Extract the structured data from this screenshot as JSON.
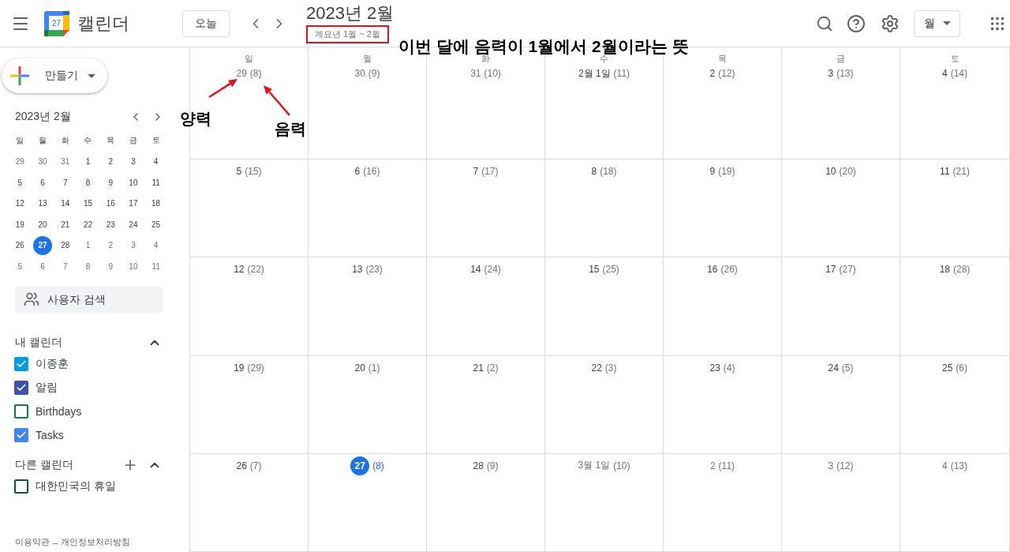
{
  "header": {
    "logo_day": "27",
    "app_name": "캘린더",
    "today_button": "오늘",
    "title": "2023년 2월",
    "subtitle": "계묘년 1월 ~ 2월",
    "subtitle_boxed": true,
    "view_button": "월"
  },
  "sidebar": {
    "create_button": "만들기",
    "mini_calendar": {
      "title": "2023년 2월",
      "weekdays": [
        "일",
        "월",
        "화",
        "수",
        "목",
        "금",
        "토"
      ],
      "weeks": [
        [
          {
            "day": "29",
            "in_month": false,
            "selected": false
          },
          {
            "day": "30",
            "in_month": false,
            "selected": false
          },
          {
            "day": "31",
            "in_month": false,
            "selected": false
          },
          {
            "day": "1",
            "in_month": true,
            "selected": false
          },
          {
            "day": "2",
            "in_month": true,
            "selected": false
          },
          {
            "day": "3",
            "in_month": true,
            "selected": false
          },
          {
            "day": "4",
            "in_month": true,
            "selected": false
          }
        ],
        [
          {
            "day": "5",
            "in_month": true,
            "selected": false
          },
          {
            "day": "6",
            "in_month": true,
            "selected": false
          },
          {
            "day": "7",
            "in_month": true,
            "selected": false
          },
          {
            "day": "8",
            "in_month": true,
            "selected": false
          },
          {
            "day": "9",
            "in_month": true,
            "selected": false
          },
          {
            "day": "10",
            "in_month": true,
            "selected": false
          },
          {
            "day": "11",
            "in_month": true,
            "selected": false
          }
        ],
        [
          {
            "day": "12",
            "in_month": true,
            "selected": false
          },
          {
            "day": "13",
            "in_month": true,
            "selected": false
          },
          {
            "day": "14",
            "in_month": true,
            "selected": false
          },
          {
            "day": "15",
            "in_month": true,
            "selected": false
          },
          {
            "day": "16",
            "in_month": true,
            "selected": false
          },
          {
            "day": "17",
            "in_month": true,
            "selected": false
          },
          {
            "day": "18",
            "in_month": true,
            "selected": false
          }
        ],
        [
          {
            "day": "19",
            "in_month": true,
            "selected": false
          },
          {
            "day": "20",
            "in_month": true,
            "selected": false
          },
          {
            "day": "21",
            "in_month": true,
            "selected": false
          },
          {
            "day": "22",
            "in_month": true,
            "selected": false
          },
          {
            "day": "23",
            "in_month": true,
            "selected": false
          },
          {
            "day": "24",
            "in_month": true,
            "selected": false
          },
          {
            "day": "25",
            "in_month": true,
            "selected": false
          }
        ],
        [
          {
            "day": "26",
            "in_month": true,
            "selected": false
          },
          {
            "day": "27",
            "in_month": true,
            "selected": true
          },
          {
            "day": "28",
            "in_month": true,
            "selected": false
          },
          {
            "day": "1",
            "in_month": false,
            "selected": false
          },
          {
            "day": "2",
            "in_month": false,
            "selected": false
          },
          {
            "day": "3",
            "in_month": false,
            "selected": false
          },
          {
            "day": "4",
            "in_month": false,
            "selected": false
          }
        ],
        [
          {
            "day": "5",
            "in_month": false,
            "selected": false
          },
          {
            "day": "6",
            "in_month": false,
            "selected": false
          },
          {
            "day": "7",
            "in_month": false,
            "selected": false
          },
          {
            "day": "8",
            "in_month": false,
            "selected": false
          },
          {
            "day": "9",
            "in_month": false,
            "selected": false
          },
          {
            "day": "10",
            "in_month": false,
            "selected": false
          },
          {
            "day": "11",
            "in_month": false,
            "selected": false
          }
        ]
      ]
    },
    "people_search": {
      "placeholder": "사용자 검색"
    },
    "calendar_groups": [
      {
        "title": "내 캘린더",
        "expanded": true,
        "can_add": false,
        "items": [
          {
            "label": "이종훈",
            "checked": true,
            "color": "#039be5"
          },
          {
            "label": "알림",
            "checked": true,
            "color": "#3f51b5"
          },
          {
            "label": "Birthdays",
            "checked": false,
            "color": "#0b8043"
          },
          {
            "label": "Tasks",
            "checked": true,
            "color": "#4285f4"
          }
        ]
      },
      {
        "title": "다른 캘린더",
        "expanded": true,
        "can_add": true,
        "items": [
          {
            "label": "대한민국의 휴일",
            "checked": false,
            "color": "#0b5c1f"
          }
        ]
      }
    ],
    "footer": {
      "links": [
        "이용약관",
        "개인정보처리방침"
      ],
      "separator": "–"
    }
  },
  "month_grid": {
    "weekdays": [
      "일",
      "월",
      "화",
      "수",
      "목",
      "금",
      "토"
    ],
    "weeks": [
      [
        {
          "date": "29",
          "lunar": "(8)",
          "in_month": false,
          "today": false
        },
        {
          "date": "30",
          "lunar": "(9)",
          "in_month": false,
          "today": false
        },
        {
          "date": "31",
          "lunar": "(10)",
          "in_month": false,
          "today": false
        },
        {
          "date": "2월 1일",
          "lunar": "(11)",
          "in_month": true,
          "today": false
        },
        {
          "date": "2",
          "lunar": "(12)",
          "in_month": true,
          "today": false
        },
        {
          "date": "3",
          "lunar": "(13)",
          "in_month": true,
          "today": false
        },
        {
          "date": "4",
          "lunar": "(14)",
          "in_month": true,
          "today": false
        }
      ],
      [
        {
          "date": "5",
          "lunar": "(15)",
          "in_month": true,
          "today": false
        },
        {
          "date": "6",
          "lunar": "(16)",
          "in_month": true,
          "today": false
        },
        {
          "date": "7",
          "lunar": "(17)",
          "in_month": true,
          "today": false
        },
        {
          "date": "8",
          "lunar": "(18)",
          "in_month": true,
          "today": false
        },
        {
          "date": "9",
          "lunar": "(19)",
          "in_month": true,
          "today": false
        },
        {
          "date": "10",
          "lunar": "(20)",
          "in_month": true,
          "today": false
        },
        {
          "date": "11",
          "lunar": "(21)",
          "in_month": true,
          "today": false
        }
      ],
      [
        {
          "date": "12",
          "lunar": "(22)",
          "in_month": true,
          "today": false
        },
        {
          "date": "13",
          "lunar": "(23)",
          "in_month": true,
          "today": false
        },
        {
          "date": "14",
          "lunar": "(24)",
          "in_month": true,
          "today": false
        },
        {
          "date": "15",
          "lunar": "(25)",
          "in_month": true,
          "today": false
        },
        {
          "date": "16",
          "lunar": "(26)",
          "in_month": true,
          "today": false
        },
        {
          "date": "17",
          "lunar": "(27)",
          "in_month": true,
          "today": false
        },
        {
          "date": "18",
          "lunar": "(28)",
          "in_month": true,
          "today": false
        }
      ],
      [
        {
          "date": "19",
          "lunar": "(29)",
          "in_month": true,
          "today": false
        },
        {
          "date": "20",
          "lunar": "(1)",
          "in_month": true,
          "today": false
        },
        {
          "date": "21",
          "lunar": "(2)",
          "in_month": true,
          "today": false
        },
        {
          "date": "22",
          "lunar": "(3)",
          "in_month": true,
          "today": false
        },
        {
          "date": "23",
          "lunar": "(4)",
          "in_month": true,
          "today": false
        },
        {
          "date": "24",
          "lunar": "(5)",
          "in_month": true,
          "today": false
        },
        {
          "date": "25",
          "lunar": "(6)",
          "in_month": true,
          "today": false
        }
      ],
      [
        {
          "date": "26",
          "lunar": "(7)",
          "in_month": true,
          "today": false
        },
        {
          "date": "27",
          "lunar": "(8)",
          "in_month": true,
          "today": true
        },
        {
          "date": "28",
          "lunar": "(9)",
          "in_month": true,
          "today": false
        },
        {
          "date": "3월 1일",
          "lunar": "(10)",
          "in_month": false,
          "today": false
        },
        {
          "date": "2",
          "lunar": "(11)",
          "in_month": false,
          "today": false
        },
        {
          "date": "3",
          "lunar": "(12)",
          "in_month": false,
          "today": false
        },
        {
          "date": "4",
          "lunar": "(13)",
          "in_month": false,
          "today": false
        }
      ]
    ]
  },
  "annotations": {
    "note": "이번 달에 음력이 1월에서 2월이라는 뜻",
    "solar_label": "양력",
    "lunar_label": "음력"
  }
}
